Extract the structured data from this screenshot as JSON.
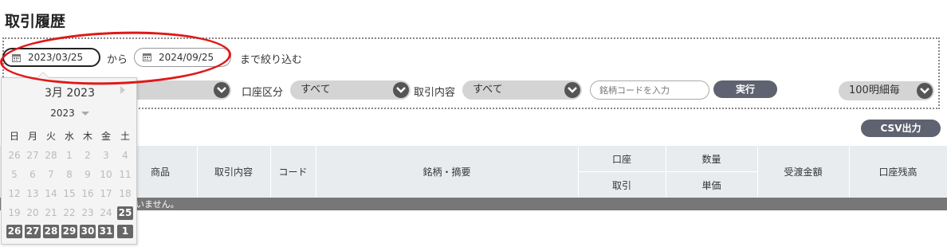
{
  "page": {
    "title": "取引履歴"
  },
  "filter": {
    "from_date": "2023/03/25",
    "from_label": "から",
    "to_date": "2024/09/25",
    "to_label": "まで絞り込む",
    "account_label": "口座区分",
    "account_value": "すべて",
    "txn_label": "取引内容",
    "txn_value": "すべて",
    "search_placeholder": "銘柄コードを入力",
    "execute_label": "実行",
    "per_page_value": "100明細毎"
  },
  "csv_label": "CSV出力",
  "table": {
    "headers": {
      "product": "商品",
      "txn": "取引内容",
      "code": "コード",
      "name": "銘柄・摘要",
      "account": "口座",
      "trade": "取引",
      "qty": "数量",
      "unit": "単価",
      "amount": "受渡金額",
      "balance": "口座残高"
    },
    "empty_message": "いません。"
  },
  "calendar": {
    "month": "3月 2023",
    "year": "2023",
    "weekdays": [
      "日",
      "月",
      "火",
      "水",
      "木",
      "金",
      "土"
    ],
    "rows": [
      [
        "26",
        "27",
        "28",
        "1",
        "2",
        "3",
        "4"
      ],
      [
        "5",
        "6",
        "7",
        "8",
        "9",
        "10",
        "11"
      ],
      [
        "12",
        "13",
        "14",
        "15",
        "16",
        "17",
        "18"
      ],
      [
        "19",
        "20",
        "21",
        "22",
        "23",
        "24",
        "25"
      ],
      [
        "26",
        "27",
        "28",
        "29",
        "30",
        "31",
        "1"
      ]
    ]
  },
  "colors": {
    "annotation": "#e01818",
    "selected_day": "#666666",
    "button": "#5f6270"
  }
}
